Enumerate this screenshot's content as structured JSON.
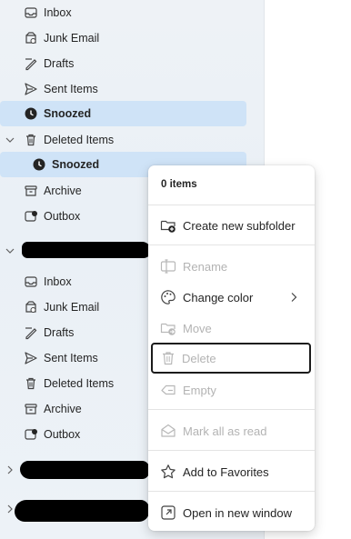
{
  "folders_account1": [
    {
      "label": "Inbox",
      "icon": "inbox-icon"
    },
    {
      "label": "Junk Email",
      "icon": "junk-icon"
    },
    {
      "label": "Drafts",
      "icon": "drafts-icon"
    },
    {
      "label": "Sent Items",
      "icon": "sent-icon"
    },
    {
      "label": "Snoozed",
      "icon": "clock-icon"
    },
    {
      "label": "Deleted Items",
      "icon": "trash-icon"
    },
    {
      "label": "Snoozed",
      "icon": "clock-icon"
    },
    {
      "label": "Archive",
      "icon": "archive-icon"
    },
    {
      "label": "Outbox",
      "icon": "outbox-icon"
    }
  ],
  "folders_account2": [
    {
      "label": "Inbox",
      "icon": "inbox-icon"
    },
    {
      "label": "Junk Email",
      "icon": "junk-icon"
    },
    {
      "label": "Drafts",
      "icon": "drafts-icon"
    },
    {
      "label": "Sent Items",
      "icon": "sent-icon"
    },
    {
      "label": "Deleted Items",
      "icon": "trash-icon"
    },
    {
      "label": "Archive",
      "icon": "archive-icon"
    },
    {
      "label": "Outbox",
      "icon": "outbox-icon"
    }
  ],
  "context_menu": {
    "header": "0 items",
    "items": [
      {
        "label": "Create new subfolder",
        "icon": "folder-add-icon",
        "enabled": true
      },
      {
        "label": "Rename",
        "icon": "rename-icon",
        "enabled": false
      },
      {
        "label": "Change color",
        "icon": "palette-icon",
        "enabled": true
      },
      {
        "label": "Move",
        "icon": "folder-move-icon",
        "enabled": false
      },
      {
        "label": "Delete",
        "icon": "trash-icon",
        "enabled": false
      },
      {
        "label": "Empty",
        "icon": "eraser-icon",
        "enabled": false
      },
      {
        "label": "Mark all as read",
        "icon": "mail-open-icon",
        "enabled": false
      },
      {
        "label": "Add to Favorites",
        "icon": "star-icon",
        "enabled": true
      },
      {
        "label": "Open in new window",
        "icon": "open-window-icon",
        "enabled": true
      }
    ]
  },
  "colors": {
    "selected_row": "#cfe3f7",
    "pane_bg": "#eef2f6",
    "disabled_text": "#b3b3b3"
  }
}
